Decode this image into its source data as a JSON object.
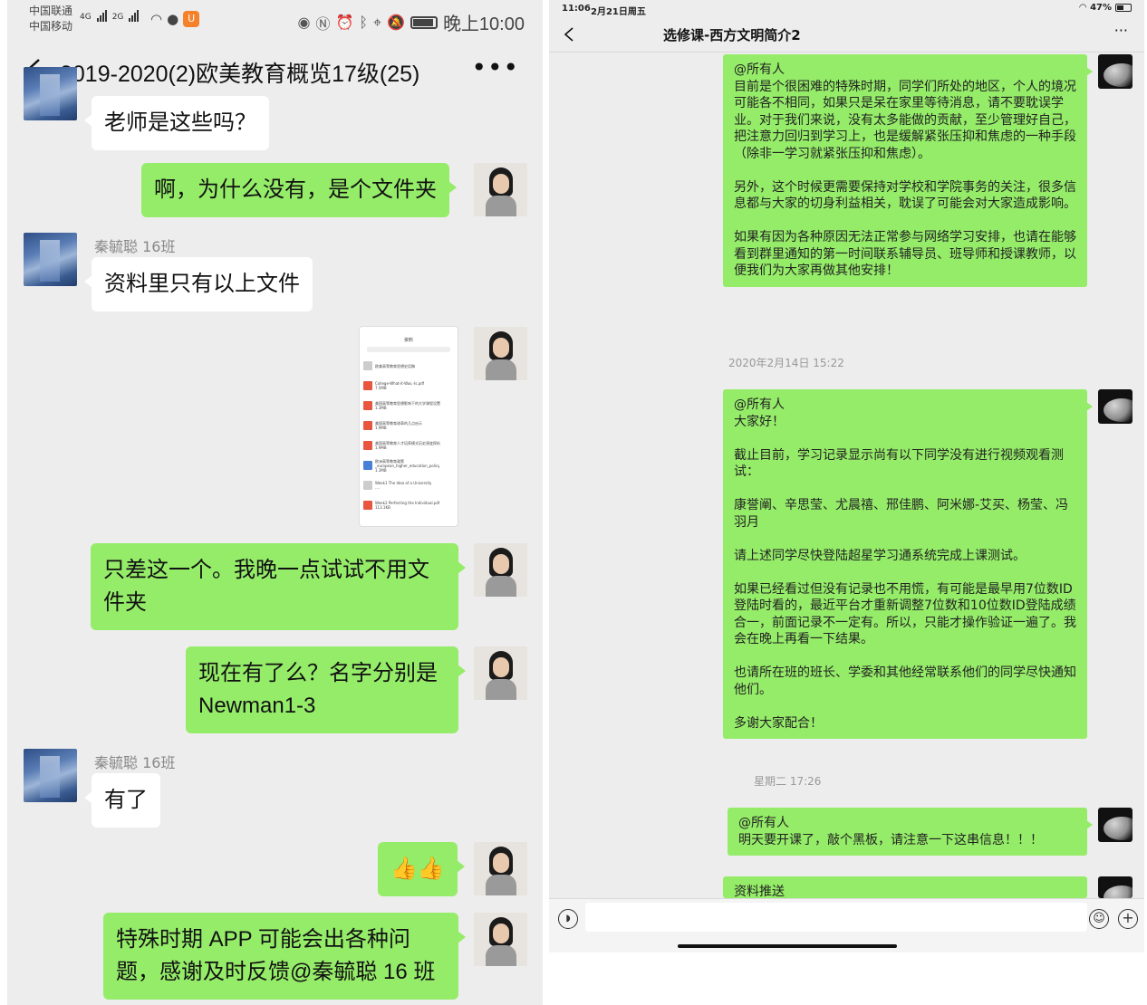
{
  "left": {
    "status": {
      "carrier1": "中国联通",
      "carrier2": "中国移动",
      "net1": "4G",
      "net2": "2G",
      "time": "晚上10:00",
      "icons": [
        "signal-icon",
        "wifi-icon",
        "wechat-icon",
        "uc-browser-icon",
        "eye-icon",
        "nfc-icon",
        "alarm-icon",
        "bluetooth-icon",
        "location-icon",
        "mute-icon",
        "battery-icon"
      ]
    },
    "title": "2019-2020(2)欧美教育概览17级(25)",
    "messages": [
      {
        "side": "in",
        "text": "老师是这些吗？"
      },
      {
        "side": "out",
        "text": "啊，为什么没有，是个文件夹"
      },
      {
        "side": "in",
        "sender": "秦毓聪 16班",
        "text": "资料里只有以上文件"
      },
      {
        "side": "out",
        "type": "image"
      },
      {
        "side": "out",
        "text": "只差这一个。我晚一点试试不用文件夹"
      },
      {
        "side": "out",
        "text": "现在有了么？名字分别是Newman1-3"
      },
      {
        "side": "in",
        "sender": "秦毓聪 16班",
        "text": "有了"
      },
      {
        "side": "out",
        "text": "👍👍"
      },
      {
        "side": "out",
        "text": "特殊时期 APP 可能会出各种问题，感谢及时反馈@秦毓聪 16 班"
      }
    ],
    "screenshot": {
      "title": "资料",
      "files": [
        {
          "icon": "folder",
          "name": "欧美高等教育思想史话稿"
        },
        {
          "icon": "pdf",
          "name": "College-What-it-Was,-Is.pdf",
          "size": "7.5MB"
        },
        {
          "icon": "pdf",
          "name": "美国高等教育思想影响下的大学课程设置",
          "size": "1.3MB"
        },
        {
          "icon": "pdf",
          "name": "美国高等教育改革的几点启示",
          "size": "1.9MB"
        },
        {
          "icon": "pdf",
          "name": "美国高等教育人才培养模式历史演变探析",
          "size": "1.9MB"
        },
        {
          "icon": "doc",
          "name": "欧洲高等教育政策",
          "sub": "_european_higher_education_policy",
          "size": "1.3MB"
        },
        {
          "icon": "link",
          "name": "Week1 The Idea of a University",
          "size": "...."
        },
        {
          "icon": "pdf",
          "name": "Week2 Perfecting the Individual.pdf",
          "size": "113.1KB"
        }
      ]
    }
  },
  "right": {
    "status": {
      "time": "11:06",
      "date": "2月21日周五",
      "battery": "47%"
    },
    "title": "选修课-西方文明简介2",
    "messages": [
      {
        "type": "msg",
        "text": "@所有人\n目前是个很困难的特殊时期，同学们所处的地区，个人的境况可能各不相同，如果只是呆在家里等待消息，请不要耽误学业。对于我们来说，没有太多能做的贡献，至少管理好自己，把注意力回归到学习上，也是缓解紧张压抑和焦虑的一种手段（除非一学习就紧张压抑和焦虑）。\n\n另外，这个时候更需要保持对学校和学院事务的关注，很多信息都与大家的切身利益相关，耽误了可能会对大家造成影响。\n\n如果有因为各种原因无法正常参与网络学习安排，也请在能够看到群里通知的第一时间联系辅导员、班导师和授课教师，以便我们为大家再做其他安排！"
      },
      {
        "type": "time",
        "text": "2020年2月14日 15:22"
      },
      {
        "type": "msg",
        "text": "@所有人\n大家好！\n\n截止目前，学习记录显示尚有以下同学没有进行视频观看测试：\n\n康誉阐、辛思莹、尤晨禧、邢佳鹏、阿米娜-艾买、杨莹、冯羽月\n\n请上述同学尽快登陆超星学习通系统完成上课测试。\n\n如果已经看过但没有记录也不用慌，有可能是最早用7位数ID登陆时看的，最近平台才重新调整7位数和10位数ID登陆成绩合一，前面记录不一定有。所以，只能才操作验证一遍了。我会在晚上再看一下结果。\n\n也请所在班的班长、学委和其他经常联系他们的同学尽快通知他们。\n\n多谢大家配合！"
      },
      {
        "type": "time",
        "text": "星期二 17:26"
      },
      {
        "type": "msg",
        "text": "@所有人\n明天要开课了，敲个黑板，请注意一下这串信息！！！"
      },
      {
        "type": "msg",
        "text": "资料推送"
      }
    ]
  }
}
